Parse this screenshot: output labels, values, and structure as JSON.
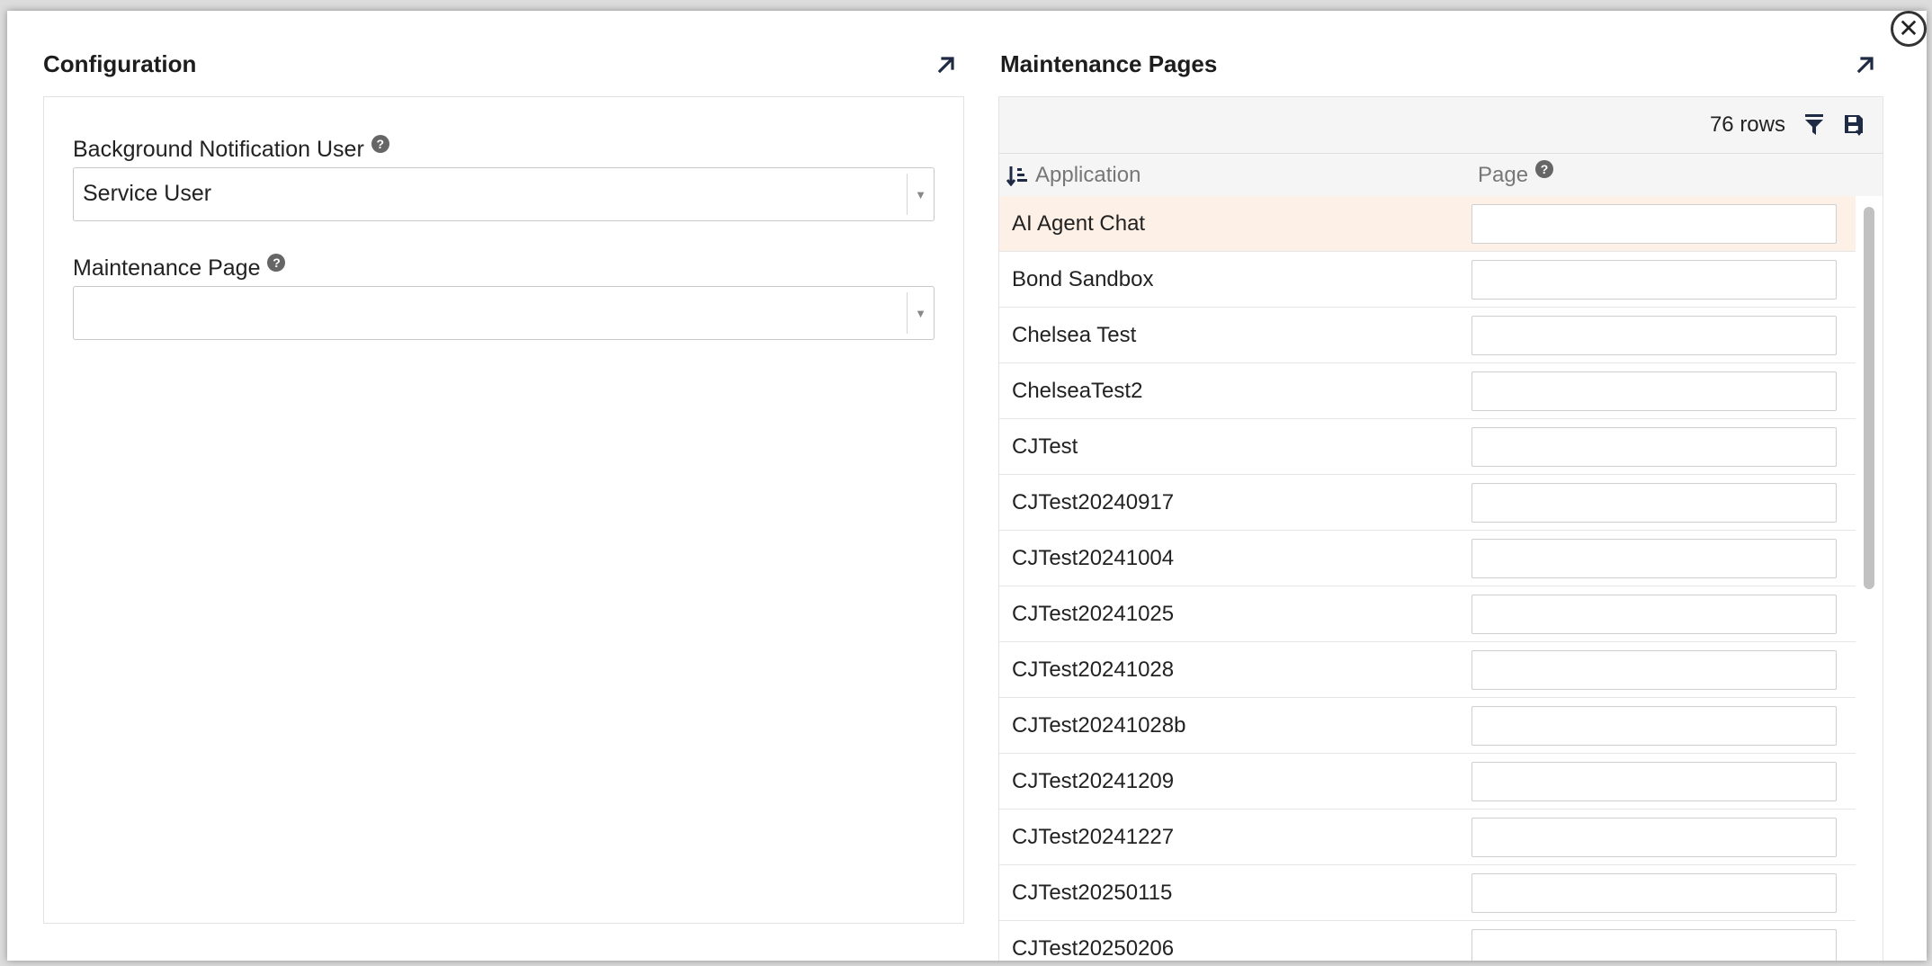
{
  "modal": {
    "close_symbol": "✕"
  },
  "configuration": {
    "title": "Configuration",
    "expand_icon": "arrow-up-right-icon",
    "fields": [
      {
        "label": "Background Notification User",
        "value": "Service User"
      },
      {
        "label": "Maintenance Page",
        "value": ""
      }
    ]
  },
  "maintenance_pages": {
    "title": "Maintenance Pages",
    "row_count": "76 rows",
    "columns": {
      "application": "Application",
      "page": "Page"
    },
    "rows": [
      {
        "application": "AI Agent Chat",
        "page": "",
        "selected": true
      },
      {
        "application": "Bond Sandbox",
        "page": ""
      },
      {
        "application": "Chelsea Test",
        "page": ""
      },
      {
        "application": "ChelseaTest2",
        "page": ""
      },
      {
        "application": "CJTest",
        "page": ""
      },
      {
        "application": "CJTest20240917",
        "page": ""
      },
      {
        "application": "CJTest20241004",
        "page": ""
      },
      {
        "application": "CJTest20241025",
        "page": ""
      },
      {
        "application": "CJTest20241028",
        "page": ""
      },
      {
        "application": "CJTest20241028b",
        "page": ""
      },
      {
        "application": "CJTest20241209",
        "page": ""
      },
      {
        "application": "CJTest20241227",
        "page": ""
      },
      {
        "application": "CJTest20250115",
        "page": ""
      },
      {
        "application": "CJTest20250206",
        "page": ""
      }
    ]
  },
  "colors": {
    "selected_row": "#fdf0e6",
    "accent_icon": "#1f2a44"
  }
}
